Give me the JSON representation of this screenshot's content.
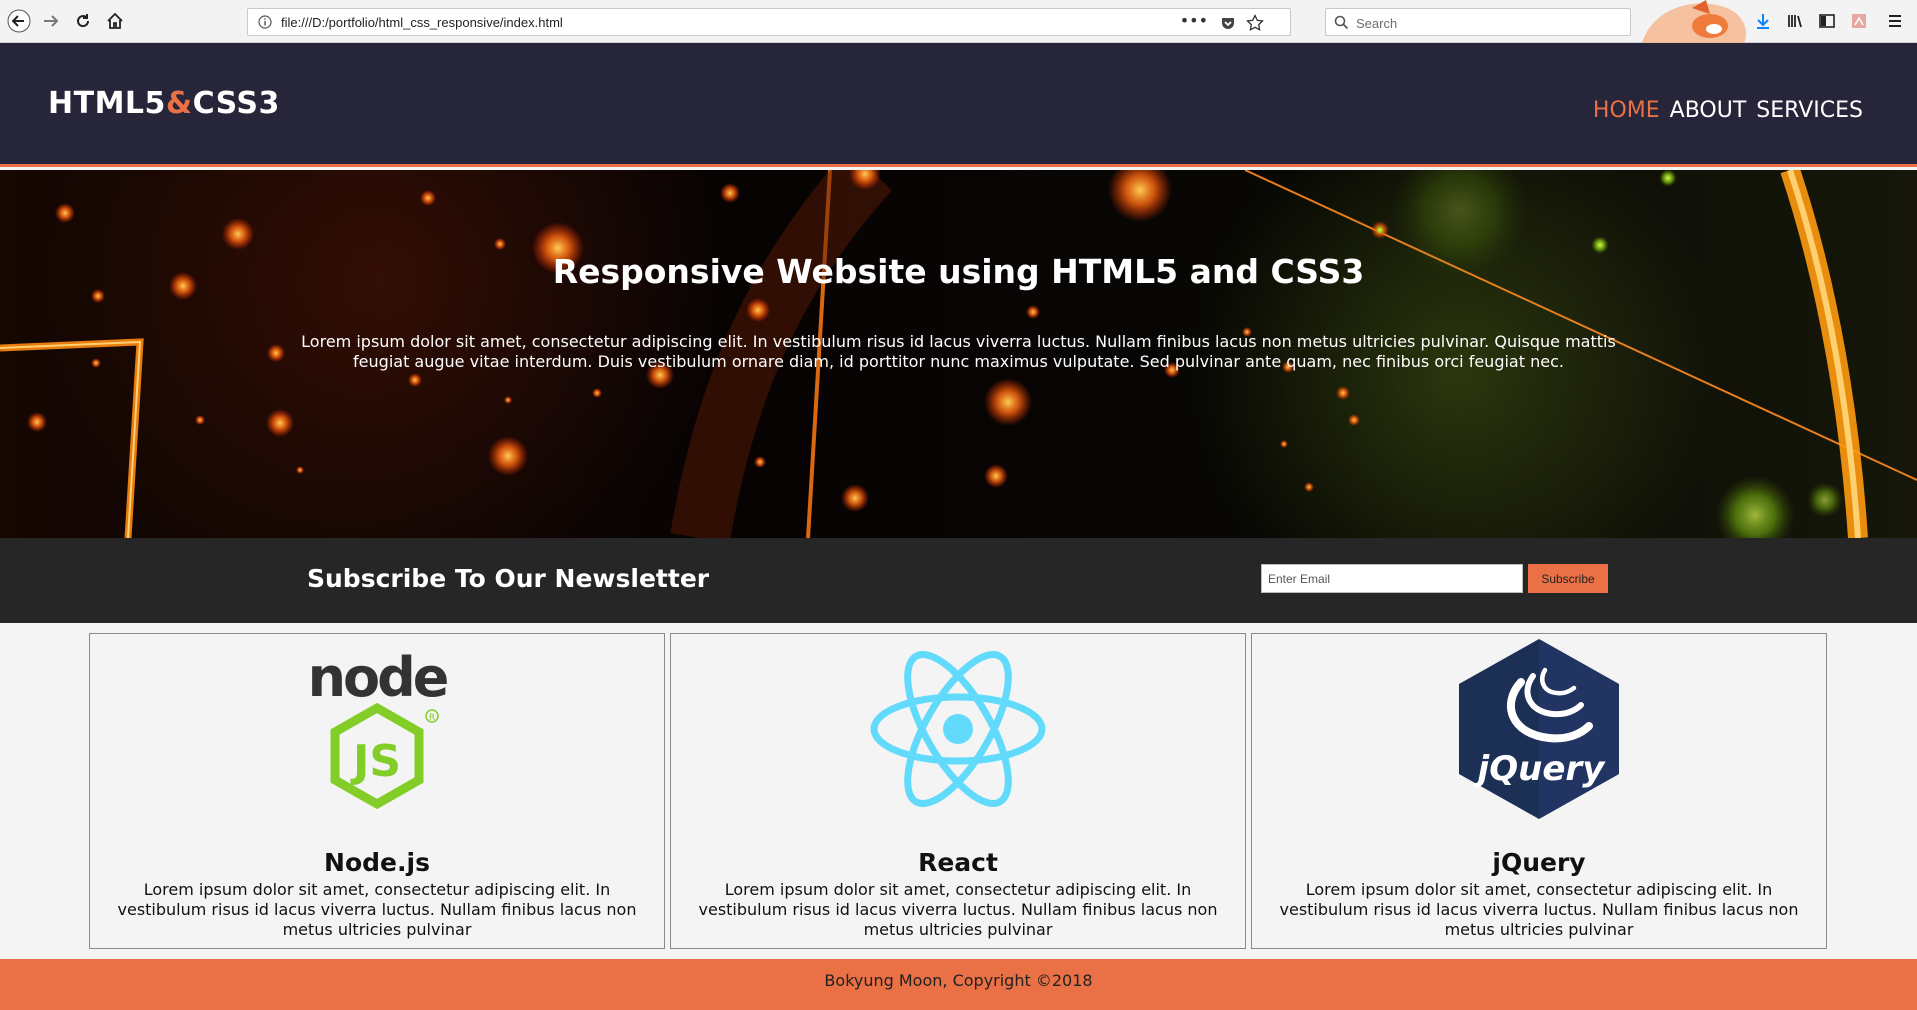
{
  "browser": {
    "url": "file:///D:/portfolio/html_css_responsive/index.html",
    "search_placeholder": "Search"
  },
  "header": {
    "logo_part1": "HTML5",
    "logo_amp": "&",
    "logo_part2": "CSS3",
    "nav": [
      "HOME",
      "ABOUT",
      "SERVICES"
    ]
  },
  "hero": {
    "title": "Responsive Website using HTML5 and CSS3",
    "text": "Lorem ipsum dolor sit amet, consectetur adipiscing elit. In vestibulum risus id lacus viverra luctus. Nullam finibus lacus non metus ultricies pulvinar. Quisque mattis feugiat augue vitae interdum. Duis vestibulum ornare diam, id porttitor nunc maximus vulputate. Sed pulvinar ante quam, nec finibus orci feugiat nec."
  },
  "newsletter": {
    "title": "Subscribe To Our Newsletter",
    "email_placeholder": "Enter Email",
    "button": "Subscribe"
  },
  "boxes": [
    {
      "title": "Node.js",
      "icon": "nodejs-logo-icon",
      "text": "Lorem ipsum dolor sit amet, consectetur adipiscing elit. In vestibulum risus id lacus viverra luctus. Nullam finibus lacus non metus ultricies pulvinar"
    },
    {
      "title": "React",
      "icon": "react-logo-icon",
      "text": "Lorem ipsum dolor sit amet, consectetur adipiscing elit. In vestibulum risus id lacus viverra luctus. Nullam finibus lacus non metus ultricies pulvinar"
    },
    {
      "title": "jQuery",
      "icon": "jquery-logo-icon",
      "text": "Lorem ipsum dolor sit amet, consectetur adipiscing elit. In vestibulum risus id lacus viverra luctus. Nullam finibus lacus non metus ultricies pulvinar"
    }
  ],
  "logos": {
    "node_word": "node",
    "node_js": "JS",
    "jquery_word": "jQuery"
  },
  "footer": {
    "text": "Bokyung Moon, Copyright ©2018"
  },
  "colors": {
    "accent": "#ea7045",
    "header_bg": "#262539",
    "newsletter_bg": "#262626",
    "node_green": "#83cd29",
    "react_blue": "#61dafb",
    "jquery_navy": "#1c2f55"
  }
}
